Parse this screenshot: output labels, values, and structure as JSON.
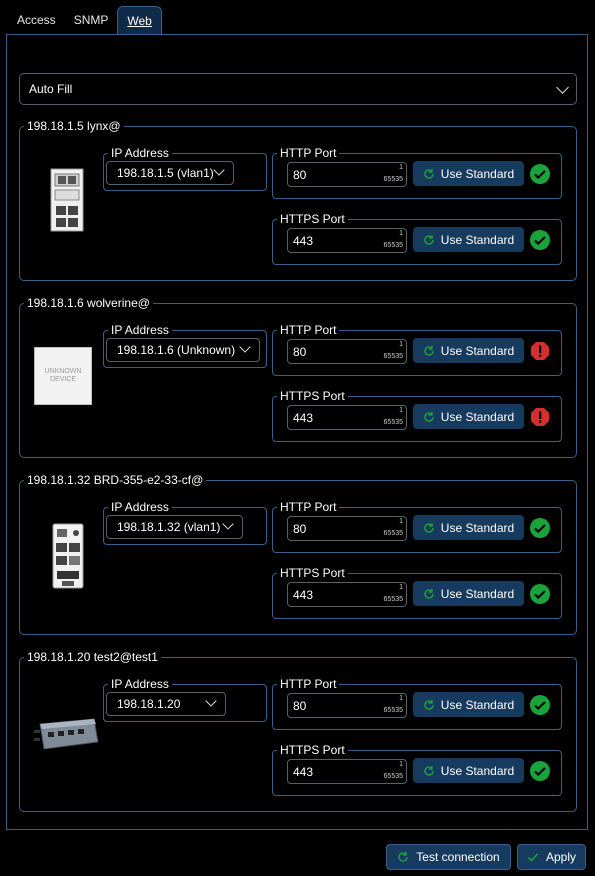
{
  "tabs": [
    {
      "label": "Access",
      "active": false
    },
    {
      "label": "SNMP",
      "active": false
    },
    {
      "label": "Web",
      "active": true
    }
  ],
  "autofill": {
    "value": "Auto Fill"
  },
  "devices": [
    {
      "title": "198.18.1.5 lynx@",
      "ip_label": "IP Address",
      "ip_value": "198.18.1.5 (vlan1)",
      "http": {
        "label": "HTTP Port",
        "value": "80",
        "min": "1",
        "max": "65535",
        "button": "Use Standard",
        "status": "ok"
      },
      "https": {
        "label": "HTTPS Port",
        "value": "443",
        "min": "1",
        "max": "65535",
        "button": "Use Standard",
        "status": "ok"
      }
    },
    {
      "title": "198.18.1.6 wolverine@",
      "ip_label": "IP Address",
      "ip_value": "198.18.1.6 (Unknown)",
      "image_text": "UNKNOWN DEVICE",
      "http": {
        "label": "HTTP Port",
        "value": "80",
        "min": "1",
        "max": "65535",
        "button": "Use Standard",
        "status": "error"
      },
      "https": {
        "label": "HTTPS Port",
        "value": "443",
        "min": "1",
        "max": "65535",
        "button": "Use Standard",
        "status": "error"
      }
    },
    {
      "title": "198.18.1.32 BRD-355-e2-33-cf@",
      "ip_label": "IP Address",
      "ip_value": "198.18.1.32 (vlan1)",
      "http": {
        "label": "HTTP Port",
        "value": "80",
        "min": "1",
        "max": "65535",
        "button": "Use Standard",
        "status": "ok"
      },
      "https": {
        "label": "HTTPS Port",
        "value": "443",
        "min": "1",
        "max": "65535",
        "button": "Use Standard",
        "status": "ok"
      }
    },
    {
      "title": "198.18.1.20 test2@test1",
      "ip_label": "IP Address",
      "ip_value": "198.18.1.20",
      "http": {
        "label": "HTTP Port",
        "value": "80",
        "min": "1",
        "max": "65535",
        "button": "Use Standard",
        "status": "ok"
      },
      "https": {
        "label": "HTTPS Port",
        "value": "443",
        "min": "1",
        "max": "65535",
        "button": "Use Standard",
        "status": "ok"
      }
    }
  ],
  "footer": {
    "test_label": "Test connection",
    "apply_label": "Apply"
  },
  "colors": {
    "ok": "#1aa33a",
    "error": "#d32f2f",
    "accent": "#173b5e",
    "border": "#3a5f8a"
  }
}
